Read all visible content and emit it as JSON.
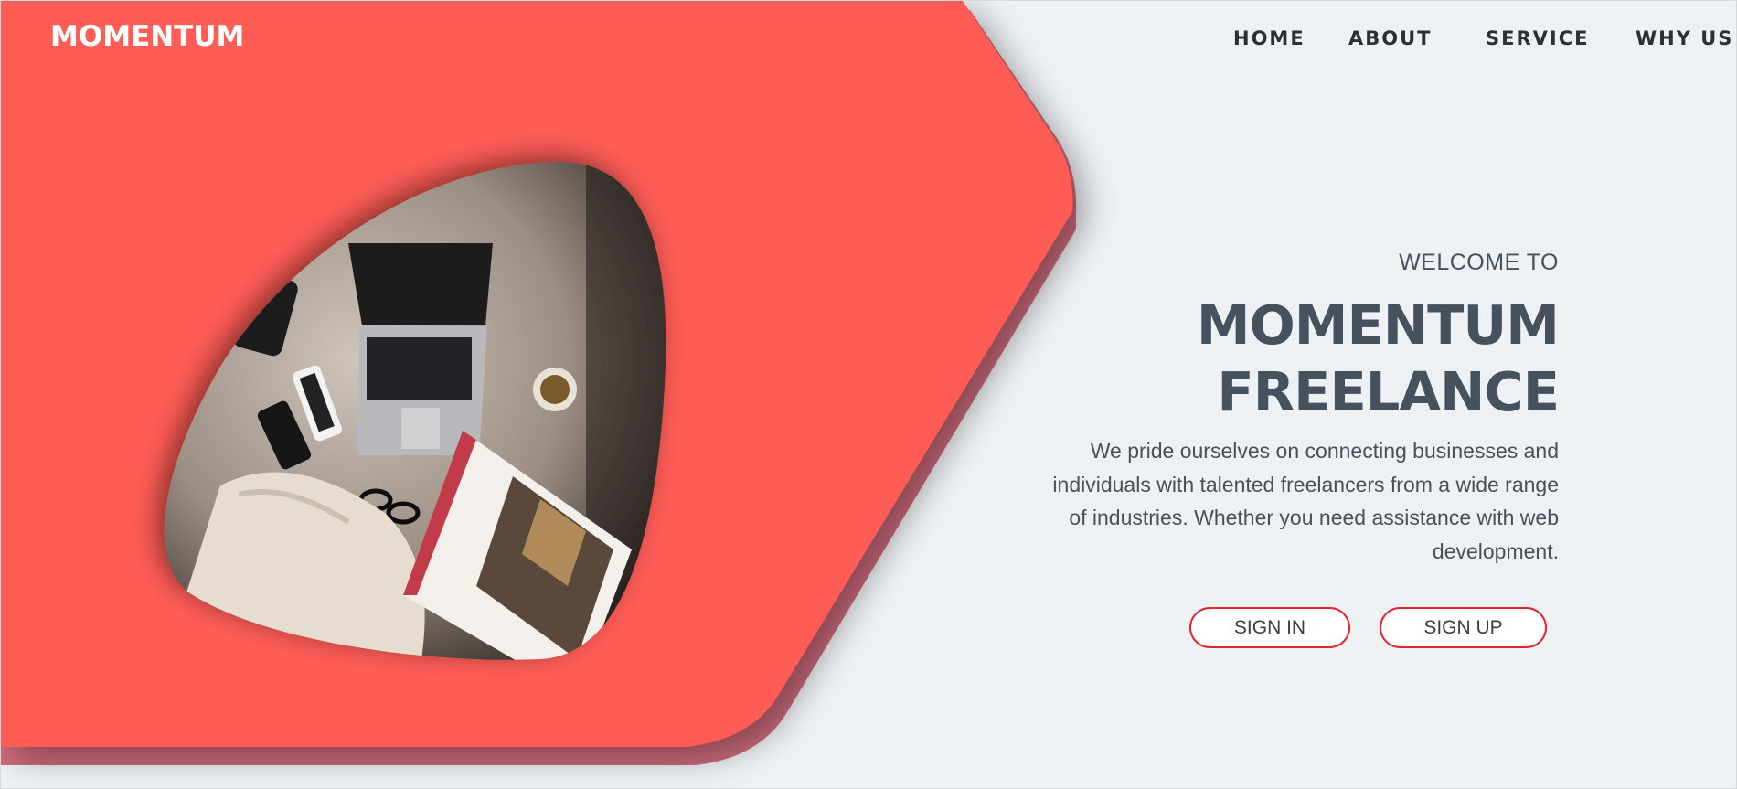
{
  "brand": "MOMENTUM",
  "nav": {
    "items": [
      "HOME",
      "ABOUT",
      "SERVICE",
      "WHY US"
    ]
  },
  "hero": {
    "welcome": "WELCOME TO",
    "title_line1": "MOMENTUM",
    "title_line2": "FREELANCE",
    "description": "We pride ourselves on connecting businesses and individuals with talented freelancers from a wide range of industries. Whether you need assistance with web development.",
    "signin_label": "SIGN IN",
    "signup_label": "SIGN UP",
    "photo_alt": "flat-lay-workspace-photo"
  },
  "colors": {
    "accent": "#ff5b56",
    "background": "#eef1f4",
    "heading": "#46515e",
    "button_border": "#e2242b"
  }
}
